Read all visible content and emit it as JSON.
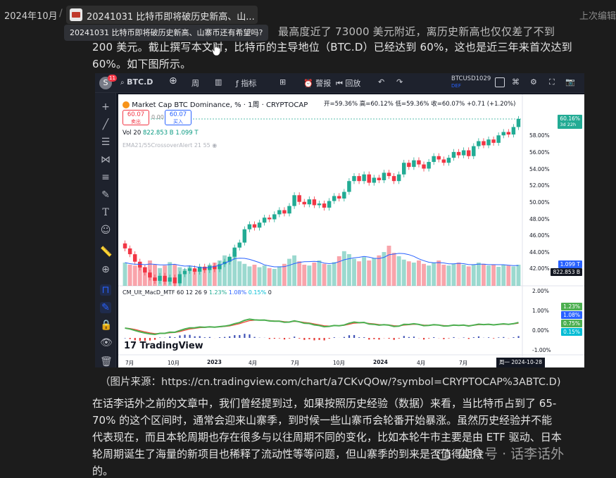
{
  "breadcrumb": {
    "year": "2024年10月",
    "separator": "/",
    "doc_title": "20241031 比特币即将破历史新高、山...",
    "last_edit": "上次编辑"
  },
  "tooltip": "20241031 比特币即将破历史新高、山寨币还有希望吗?",
  "article": {
    "line1_partial": "最高度近了 73000 美元附近，离历史新高也仅仅差了不到",
    "line2": "200 美元。截止撰写本文时，比特币的主导地位（BTC.D）已经达到 60%，这也是近三年来首次达到",
    "line3": "60%。如下图所示。",
    "caption": "（图片来源：https://cn.tradingview.com/chart/a7CKvQOw/?symbol=CRYPTOCAP%3ABTC.D)",
    "para2": [
      "在话李话外之前的文章中，我们曾经提到过，如果按照历史经验（数据）来看，当比特币占到了 65-",
      "70% 的这个区间时，通常会迎来山寨季，到时候一些山寨币会轮番开始暴涨。虽然历史经验并不能",
      "代表现在，而且本轮周期也存在很多与以往周期不同的变化，比如本轮牛市主要是由 ETF 驱动、日本",
      "轮周期诞生了海量的新项目也稀释了流动性等等问题，但山寨季的到来是否值得期待",
      "的。"
    ]
  },
  "watermark": "公众号 · 话李话外",
  "tv": {
    "toolbar": {
      "symbol": "BTC.D",
      "interval": "周",
      "indicators": "指标",
      "alert": "警报",
      "replay": "回放",
      "ticker": "BTCUSD1029",
      "ticker_sub": "DEF",
      "badge": "11"
    },
    "legend": {
      "title": "Market Cap BTC Dominance, % · 1周 · CRYPTOCAP",
      "ohlc": "开=59.36% 高=60.12% 低=59.36% 收=60.07% +0.71 (+1.20%)",
      "sell_price": "60.07",
      "sell_label": "卖出",
      "buy_price": "60.07",
      "buy_label": "买入",
      "spread": "0.00",
      "vol": "Vol 20",
      "vol_v1": "822.853 B",
      "vol_v2": "1.099 T",
      "ema": "EMA21/55CrossoverAlert 21 55",
      "macd_name": "CM_Ult_MacD_MTF 60 12 26 9",
      "macd_v1": "1.23%",
      "macd_v2": "1.08%",
      "macd_v3": "0.15%",
      "macd_v4": "0"
    },
    "logo": "TradingView",
    "price_axis": [
      "60.16%",
      "58.00%",
      "56.00%",
      "54.00%",
      "52.00%",
      "50.00%",
      "48.00%",
      "46.00%",
      "44.00%",
      "42.00%"
    ],
    "price_tag": "60.16%",
    "price_tag_sub": "3d 22h",
    "vol_tags": [
      "1.099 T",
      "822.853 B"
    ],
    "macd_axis": [
      "2.00%",
      "1.00%",
      "0.00%",
      "-1.00%"
    ],
    "macd_tags": [
      "1.23%",
      "1.08%",
      "0.75%",
      "0.15%"
    ],
    "time_axis": [
      "7月",
      "10月",
      "2023",
      "4月",
      "7月",
      "10月",
      "2024",
      "4月",
      "7月"
    ],
    "date_tag": "周一 2024-10-28",
    "colors": {
      "up": "#22ab94",
      "down": "#f23645",
      "macd_line": "#4caf50",
      "signal_line": "#f44336",
      "ema_blue": "#2962ff"
    }
  },
  "chart_data": {
    "type": "candlestick",
    "title": "Market Cap BTC Dominance, % · 1周 · CRYPTOCAP",
    "x_start_label": "7月",
    "ylim": [
      40,
      61
    ],
    "closes": [
      44.5,
      43.8,
      42.9,
      42.2,
      41.6,
      41.0,
      40.6,
      41.2,
      40.5,
      41.0,
      40.3,
      41.4,
      41.8,
      42.1,
      41.7,
      42.3,
      41.9,
      42.4,
      42.0,
      42.6,
      42.9,
      43.5,
      44.6,
      45.2,
      46.8,
      47.4,
      47.0,
      47.6,
      48.2,
      48.0,
      48.6,
      49.1,
      48.7,
      49.6,
      50.9,
      50.1,
      49.8,
      50.4,
      49.7,
      49.9,
      49.4,
      50.2,
      50.8,
      50.5,
      51.3,
      52.6,
      53.2,
      52.6,
      53.4,
      52.4,
      53.0,
      52.7,
      53.6,
      53.2,
      52.6,
      53.4,
      54.8,
      54.3,
      55.1,
      54.6,
      54.1,
      54.9,
      55.6,
      55.2,
      54.8,
      55.4,
      56.1,
      55.7,
      56.3,
      55.6,
      56.8,
      57.4,
      56.9,
      57.6,
      57.2,
      58.1,
      58.5,
      58.2,
      59.1,
      60.07
    ],
    "volume_relative": [
      0.55,
      0.5,
      0.48,
      0.52,
      0.45,
      0.6,
      0.5,
      0.42,
      0.48,
      0.56,
      0.5,
      0.44,
      0.4,
      0.46,
      0.38,
      0.42,
      0.45,
      0.5,
      0.55,
      0.6,
      0.72,
      0.68,
      0.8,
      0.58,
      0.52,
      0.46,
      0.5,
      0.44,
      0.48,
      0.42,
      0.4,
      0.46,
      0.52,
      0.64,
      0.72,
      0.58,
      0.5,
      0.48,
      0.55,
      0.6,
      0.52,
      0.5,
      0.56,
      0.7,
      0.82,
      0.75,
      0.64,
      0.58,
      0.68,
      0.6,
      0.66,
      0.72,
      0.8,
      0.95,
      0.78,
      0.7,
      0.62,
      0.58,
      0.55,
      0.6,
      0.52,
      0.48,
      0.55,
      0.6,
      0.5,
      0.48,
      0.52,
      0.55,
      0.5,
      0.46,
      0.5,
      0.55,
      0.52,
      0.48,
      0.5,
      0.45,
      0.5,
      0.48,
      0.46,
      0.5
    ]
  }
}
